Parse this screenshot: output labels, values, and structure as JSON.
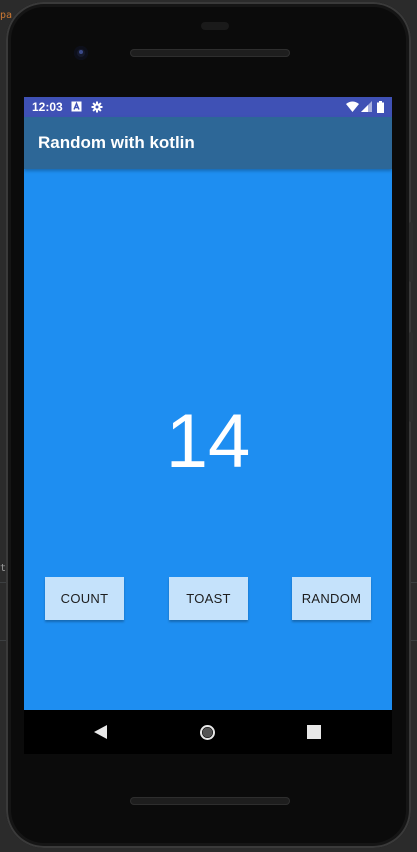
{
  "status_bar": {
    "time": "12:03",
    "icons": [
      "notification-a-icon",
      "settings-gear-icon",
      "wifi-icon",
      "signal-icon",
      "battery-icon"
    ]
  },
  "app": {
    "title": "Random with kotlin",
    "count_value": "14"
  },
  "buttons": {
    "count": "COUNT",
    "toast": "TOAST",
    "random": "RANDOM"
  },
  "nav_bar": {
    "icons": [
      "back-icon",
      "home-icon",
      "overview-icon"
    ]
  },
  "ide_fragments": {
    "top_left": "pa",
    "left_side": "ti"
  },
  "colors": {
    "status_bar": "#3f51b5",
    "app_bar": "#2d6797",
    "screen_background": "#1e8ef1",
    "button_background": "#c5e2fb",
    "text_on_primary": "#ffffff"
  }
}
